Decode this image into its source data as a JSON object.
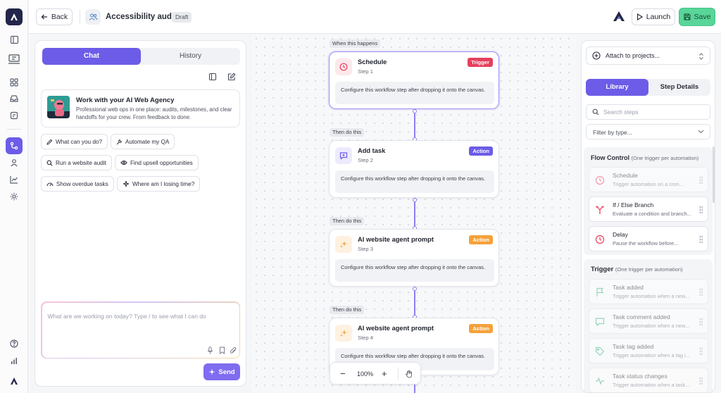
{
  "topbar": {
    "back_label": "Back",
    "title": "Accessibility audit",
    "status_badge": "Draft",
    "launch_label": "Launch",
    "save_label": "Save"
  },
  "chat_panel": {
    "tabs": [
      {
        "label": "Chat",
        "active": true
      },
      {
        "label": "History",
        "active": false
      }
    ],
    "agency_card": {
      "title": "Work with your AI Web Agency",
      "description": "Professional web ops in one place: audits, milestones, and clear handoffs for your crew. From feedback to done."
    },
    "suggestions": [
      {
        "label": "What can you do?",
        "icon": "pencil-icon"
      },
      {
        "label": "Automate my QA",
        "icon": "wrench-icon"
      },
      {
        "label": "Run a website audit",
        "icon": "search-icon"
      },
      {
        "label": "Find upsell opportunities",
        "icon": "eye-icon"
      },
      {
        "label": "Show overdue tasks",
        "icon": "gauge-icon"
      },
      {
        "label": "Where am I losing time?",
        "icon": "sparkle-icon"
      }
    ],
    "composer_placeholder": "What are we working on today? Type / to see what I can do",
    "send_label": "Send"
  },
  "workflow": {
    "labels": [
      "When this happens",
      "Then do this",
      "Then do this",
      "Then do this"
    ],
    "nodes": [
      {
        "title": "Schedule",
        "step": "Step 1",
        "tag": "Trigger",
        "tag_color": "#e5405e",
        "icon": "clock-icon",
        "description": "Configure this workflow step after dropping it onto the canvas."
      },
      {
        "title": "Add task",
        "step": "Step 2",
        "tag": "Action",
        "tag_color": "#6c5ce7",
        "icon": "task-icon",
        "description": "Configure this workflow step after dropping it onto the canvas."
      },
      {
        "title": "AI website agent prompt",
        "step": "Step 3",
        "tag": "Action",
        "tag_color": "#f5a13a",
        "icon": "sparkle-icon",
        "description": "Configure this workflow step after dropping it onto the canvas."
      },
      {
        "title": "AI website agent prompt",
        "step": "Step 4",
        "tag": "Action",
        "tag_color": "#f5a13a",
        "icon": "sparkle-icon",
        "description": "Configure this workflow step after dropping it onto the canvas."
      }
    ],
    "zoom_level": "100%"
  },
  "library_panel": {
    "attach_label": "Attach to projects...",
    "tabs": [
      {
        "label": "Library",
        "active": true
      },
      {
        "label": "Step Details",
        "active": false
      }
    ],
    "search_placeholder": "Search steps",
    "filter_label": "Filter by type...",
    "flow_control": {
      "title": "Flow Control",
      "note": "(One trigger per automation)",
      "items": [
        {
          "title": "Schedule",
          "subtitle": "Trigger automation on a cron...",
          "icon": "clock-icon",
          "disabled": true
        },
        {
          "title": "If / Else Branch",
          "subtitle": "Evaluate a condition and branch...",
          "icon": "branch-icon",
          "disabled": false
        },
        {
          "title": "Delay",
          "subtitle": "Pause the workflow before...",
          "icon": "clock-icon",
          "disabled": false
        }
      ]
    },
    "trigger": {
      "title": "Trigger",
      "note": "(One trigger per automation)",
      "items": [
        {
          "title": "Task added",
          "subtitle": "Trigger automation when a new...",
          "icon": "flag-icon",
          "disabled": true
        },
        {
          "title": "Task comment added",
          "subtitle": "Trigger automation when a new...",
          "icon": "comment-icon",
          "disabled": true
        },
        {
          "title": "Task tag added",
          "subtitle": "Trigger automation when a tag i...",
          "icon": "tag-icon",
          "disabled": true
        },
        {
          "title": "Task status changes",
          "subtitle": "Trigger automation when a task...",
          "icon": "pulse-icon",
          "disabled": true
        }
      ]
    }
  },
  "colors": {
    "accent": "#6c5ce7",
    "save_green": "#5ad59a",
    "trigger_red": "#e5405e",
    "action_orange": "#f5a13a"
  }
}
